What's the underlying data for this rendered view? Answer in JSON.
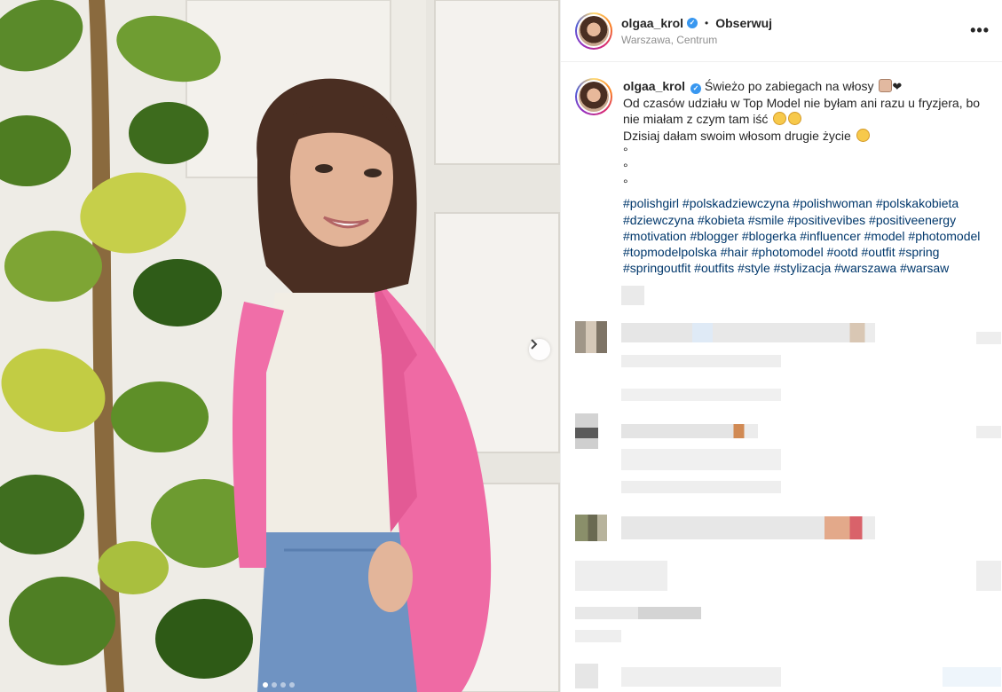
{
  "post": {
    "username": "olgaa_krol",
    "follow_label": "Obserwuj",
    "separator": "•",
    "location": "Warszawa, Centrum",
    "more_label": "•••"
  },
  "caption": {
    "username": "olgaa_krol",
    "line1": "Świeżo po zabiegach na włosy",
    "line2": "Od czasów udziału w Top Model nie byłam ani razu u fryzjera, bo nie miałam z czym tam iść",
    "line3": "Dzisiaj dałam swoim włosom drugie życie",
    "dot_lines": [
      "°",
      "°",
      "°"
    ],
    "hashtags": "#polishgirl #polskadziewczyna #polishwoman #polskakobieta #dziewczyna #kobieta #smile #positivevibes #positiveenergy #motivation #blogger #blogerka #influencer #model #photomodel #topmodelpolska #hair #photomodel #ootd #outfit #spring #springoutfit #outfits #style #stylizacja #warszawa #warsaw"
  },
  "carousel": {
    "slide_count": 4,
    "active_index": 0
  },
  "icons": {
    "verified": "verified-badge-icon",
    "next": "chevron-right-icon",
    "more": "more-options-icon"
  },
  "colors": {
    "verified_blue": "#3897f0",
    "hashtag_blue": "#00376b",
    "muted": "#8e8e8e",
    "jacket_pink": "#f06ea8"
  }
}
